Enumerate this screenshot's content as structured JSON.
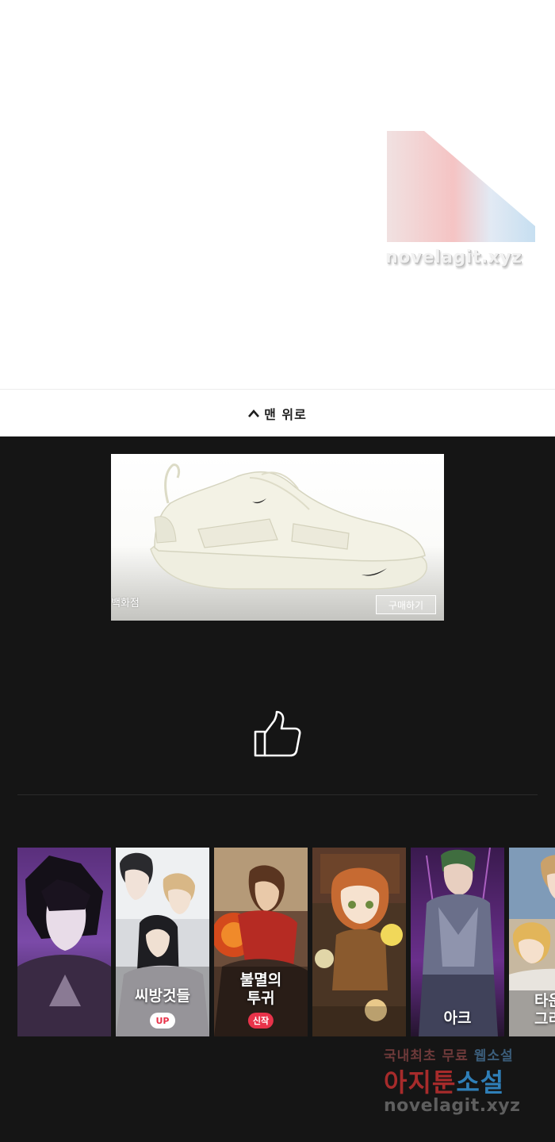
{
  "watermark": {
    "top_text": "novelagit.xyz",
    "bottom_line1_part1": "국내최초 무료",
    "bottom_line1_part2": "웹소설",
    "bottom_line2_part1": "아지툰",
    "bottom_line2_part2": "소설",
    "bottom_line3": "novelagit.xyz"
  },
  "nav": {
    "back_to_top_label": "맨 위로",
    "back_to_top_icon": "chevron-up-icon"
  },
  "ad": {
    "shop_label": "백화점",
    "buy_button": "구매하기",
    "image": "white-sneaker"
  },
  "like": {
    "icon": "thumbs-up-icon"
  },
  "recommendations": [
    {
      "title": "",
      "badge": "",
      "art": "dark-hooded-boy"
    },
    {
      "title": "씨방것들",
      "badge": "UP",
      "art": "romance-couple"
    },
    {
      "title": "불멸의\n투귀",
      "badge": "신작",
      "art": "warrior-fire"
    },
    {
      "title": "",
      "badge": "",
      "art": "girl-with-book"
    },
    {
      "title": "아크",
      "badge": "",
      "art": "armored-hero"
    },
    {
      "title": "타운\n그리",
      "badge": "",
      "art": "blonde-boys"
    }
  ],
  "colors": {
    "background_dark": "#151515",
    "badge_red": "#e8334a",
    "watermark_red": "#a72b2b",
    "watermark_blue": "#2f7fb8"
  }
}
